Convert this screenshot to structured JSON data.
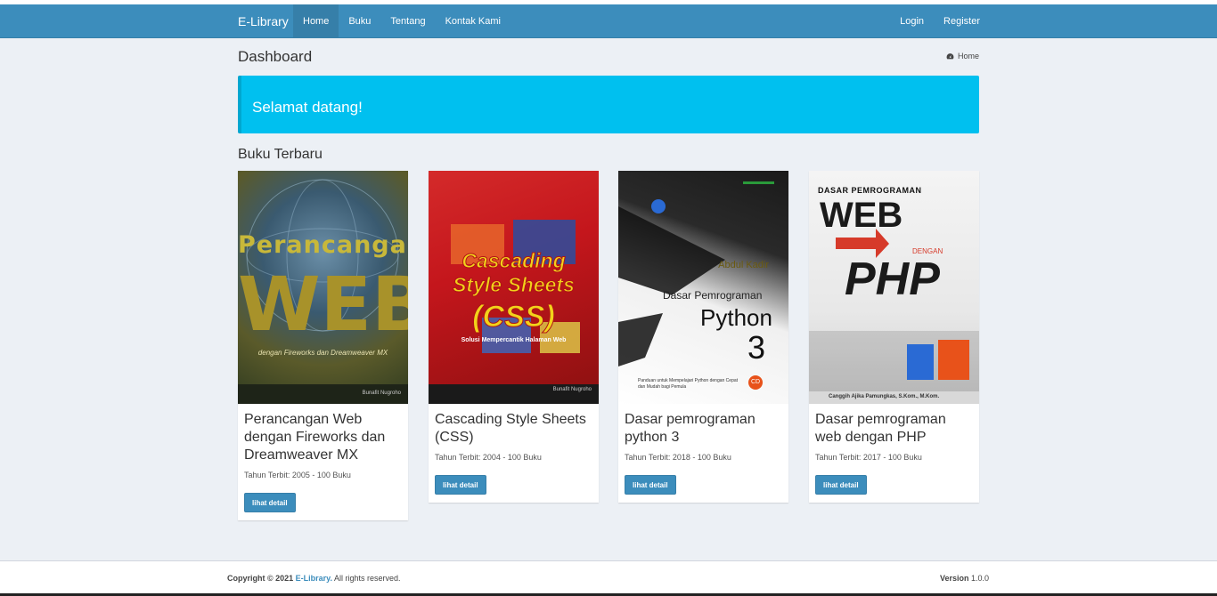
{
  "navbar": {
    "brand": "E-Library",
    "links": [
      {
        "label": "Home"
      },
      {
        "label": "Buku"
      },
      {
        "label": "Tentang"
      },
      {
        "label": "Kontak Kami"
      }
    ],
    "right_links": [
      {
        "label": "Login"
      },
      {
        "label": "Register"
      }
    ]
  },
  "header": {
    "title": "Dashboard",
    "breadcrumb": "Home"
  },
  "callout": {
    "text": "Selamat datang!"
  },
  "section": {
    "title": "Buku Terbaru"
  },
  "books": [
    {
      "title": "Perancangan Web dengan Fireworks dan Dreamweaver MX",
      "meta": "Tahun Terbit: 2005 - 100 Buku",
      "button": "lihat detail",
      "cover": {
        "line1": "Perancangan",
        "line2": "WEB",
        "line3": "dengan Fireworks dan Dreamweaver MX",
        "author": "Bunafit Nugroho"
      }
    },
    {
      "title": "Cascading Style Sheets (CSS)",
      "meta": "Tahun Terbit: 2004 - 100 Buku",
      "button": "lihat detail",
      "cover": {
        "line1": "Cascading",
        "line2": "Style Sheets",
        "line3": "(CSS)",
        "line4": "Solusi Mempercantik Halaman Web",
        "author": "Bunafit Nugroho"
      }
    },
    {
      "title": "Dasar pemrograman python 3",
      "meta": "Tahun Terbit: 2018 - 100 Buku",
      "button": "lihat detail",
      "cover": {
        "author": "Abdul Kadir",
        "line1": "Dasar Pemrograman",
        "line2": "Python",
        "line3": "3",
        "line4": "Panduan untuk Mempelajari Python dengan Cepat dan Mudah bagi Pemula",
        "badge": "CD"
      }
    },
    {
      "title": "Dasar pemrograman web dengan PHP",
      "meta": "Tahun Terbit: 2017 - 100 Buku",
      "button": "lihat detail",
      "cover": {
        "line0": "DASAR PEMROGRAMAN",
        "line1": "WEB",
        "line2": "DENGAN",
        "line3": "PHP",
        "author": "Canggih Ajika Pamungkas, S.Kom., M.Kom."
      }
    }
  ],
  "footer": {
    "copyright_prefix": "Copyright © 2021",
    "copyright_brand": "E-Library.",
    "copyright_suffix": "All rights reserved.",
    "version_label": "Version",
    "version_value": "1.0.0"
  }
}
